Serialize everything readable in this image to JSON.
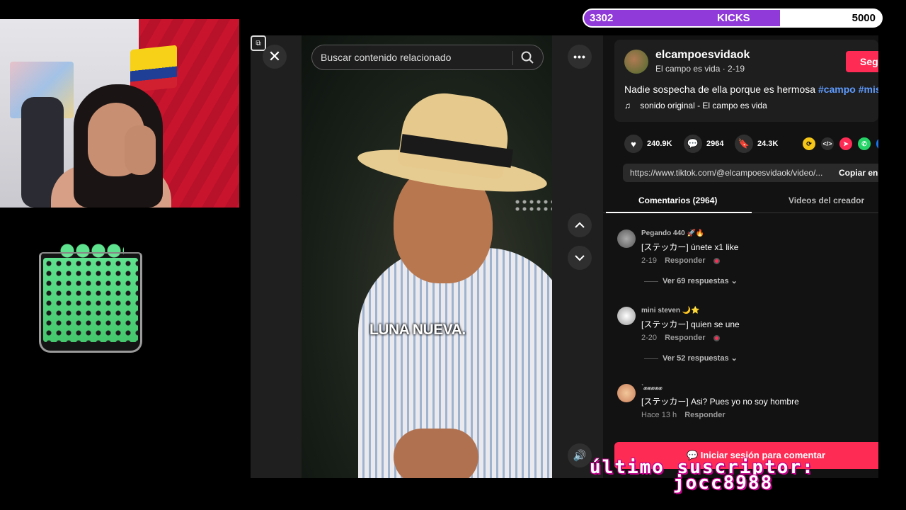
{
  "kicks": {
    "current": "3302",
    "label": "KICKS",
    "goal": "5000",
    "progress": 0.66,
    "fill_color": "#8f3ad9"
  },
  "tiktok": {
    "search": {
      "placeholder": "Buscar contenido relacionado"
    },
    "video": {
      "caption": "LUNA NUEVA."
    },
    "author": {
      "username": "elcampoesvidaok",
      "subline": "El campo es vida · 2-19",
      "follow_label": "Seg"
    },
    "description": {
      "text": "Nadie sospecha de ella porque es hermosa",
      "tags": [
        "#campo",
        "#miste"
      ]
    },
    "sound": "sonido original - El campo es vida",
    "stats": {
      "likes": "240.9K",
      "comments": "2964",
      "saves": "24.3K"
    },
    "link": {
      "url": "https://www.tiktok.com/@elcampoesvidaok/video/...",
      "copy_label": "Copiar enl"
    },
    "tabs": {
      "comments": "Comentarios (2964)",
      "videos": "Videos del creador"
    },
    "comments": [
      {
        "name": "Pegando 440 🚀🔥",
        "text": "[ステッカー] únete x1 like",
        "date": "2-19",
        "reply": "Responder",
        "more": "Ver 69 respuestas"
      },
      {
        "name": "mini steven 🌙⭐",
        "text": "[ステッカー] quien se une",
        "date": "2-20",
        "reply": "Responder",
        "more": "Ver 52 respuestas"
      },
      {
        "name": "ˋ𝔁𝔁𝔁𝔁𝔁",
        "text": "[ステッカー] Asi? Pues yo no soy hombre",
        "date": "Hace 13 h",
        "reply": "Responder"
      }
    ],
    "login_label": "Iniciar sesión para comentar"
  },
  "subscriber": {
    "line1": "último suscriptor:",
    "line2": "jocc8988"
  },
  "colors": {
    "accent": "#fe2c55",
    "tag": "#5f9cff"
  }
}
